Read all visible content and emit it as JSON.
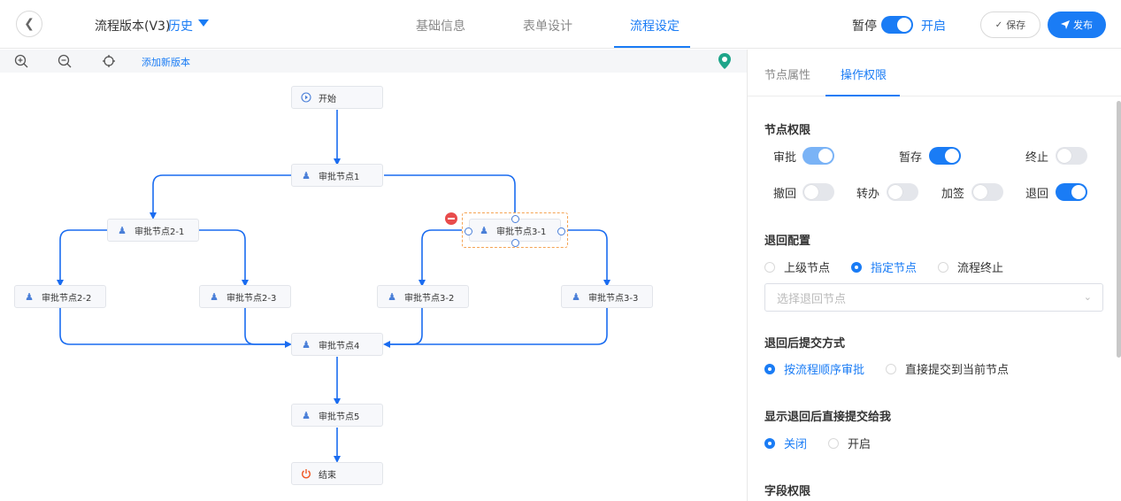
{
  "header": {
    "version_title": "流程版本(V3)",
    "history_label": "历史",
    "tabs": [
      {
        "label": "基础信息"
      },
      {
        "label": "表单设计"
      },
      {
        "label": "流程设定"
      }
    ],
    "pause_label": "暂停",
    "open_label": "开启",
    "toggle_on": true,
    "save_label": "保存",
    "publish_label": "发布"
  },
  "toolbar": {
    "add_version": "添加新版本",
    "icons": [
      "zoom-in-icon",
      "zoom-out-icon",
      "locate-icon",
      "location-pin-icon"
    ]
  },
  "flow": {
    "start": "开始",
    "node1": "审批节点1",
    "node2_1": "审批节点2-1",
    "node2_2": "审批节点2-2",
    "node2_3": "审批节点2-3",
    "node3_1": "审批节点3-1",
    "node3_2": "审批节点3-2",
    "node3_3": "审批节点3-3",
    "node4": "审批节点4",
    "node5": "审批节点5",
    "end": "结束"
  },
  "panel": {
    "tabs": [
      {
        "label": "节点属性"
      },
      {
        "label": "操作权限"
      }
    ],
    "node_perm": {
      "title": "节点权限",
      "items": [
        {
          "label": "审批",
          "state": "on-disabled"
        },
        {
          "label": "暂存",
          "state": "on"
        },
        {
          "label": "终止",
          "state": "off"
        },
        {
          "label": "撤回",
          "state": "off"
        },
        {
          "label": "转办",
          "state": "off"
        },
        {
          "label": "加签",
          "state": "off"
        },
        {
          "label": "退回",
          "state": "on"
        }
      ]
    },
    "return_config": {
      "title": "退回配置",
      "options": [
        "上级节点",
        "指定节点",
        "流程终止"
      ],
      "selected": "指定节点",
      "select_placeholder": "选择退回节点"
    },
    "submit_mode": {
      "title": "退回后提交方式",
      "options": [
        "按流程顺序审批",
        "直接提交到当前节点"
      ],
      "selected": "按流程顺序审批"
    },
    "show_direct": {
      "title": "显示退回后直接提交给我",
      "options": [
        "关闭",
        "开启"
      ],
      "selected": "关闭"
    },
    "field_perm": {
      "title": "字段权限"
    }
  },
  "colors": {
    "accent": "#1a7cf5",
    "danger": "#e84c4c",
    "selected_border": "#f5a454"
  }
}
